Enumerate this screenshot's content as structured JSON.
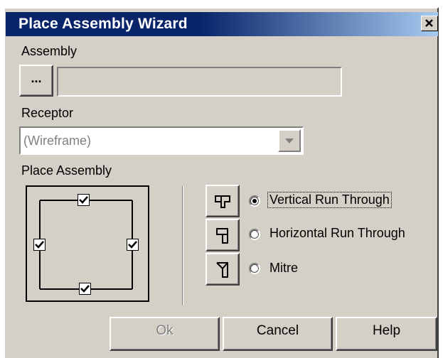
{
  "window": {
    "title": "Place Assembly Wizard",
    "close_glyph": "✕"
  },
  "assembly": {
    "label": "Assembly",
    "browse_label": "...",
    "value": ""
  },
  "receptor": {
    "label": "Receptor",
    "selected": "(Wireframe)"
  },
  "place_assembly": {
    "label": "Place Assembly",
    "checkboxes": {
      "top": true,
      "left": true,
      "right": true,
      "bottom": true
    },
    "options": [
      {
        "label": "Vertical Run Through",
        "selected": true,
        "icon": "vertical-run-through-icon"
      },
      {
        "label": "Horizontal Run Through",
        "selected": false,
        "icon": "horizontal-run-through-icon"
      },
      {
        "label": "Mitre",
        "selected": false,
        "icon": "mitre-icon"
      }
    ]
  },
  "buttons": {
    "ok": "Ok",
    "cancel": "Cancel",
    "help": "Help"
  },
  "colors": {
    "title_bar_start": "#0a246a",
    "title_bar_end": "#a6caf0",
    "dialog_bg": "#d4d0c8",
    "disabled_text": "#808080"
  }
}
